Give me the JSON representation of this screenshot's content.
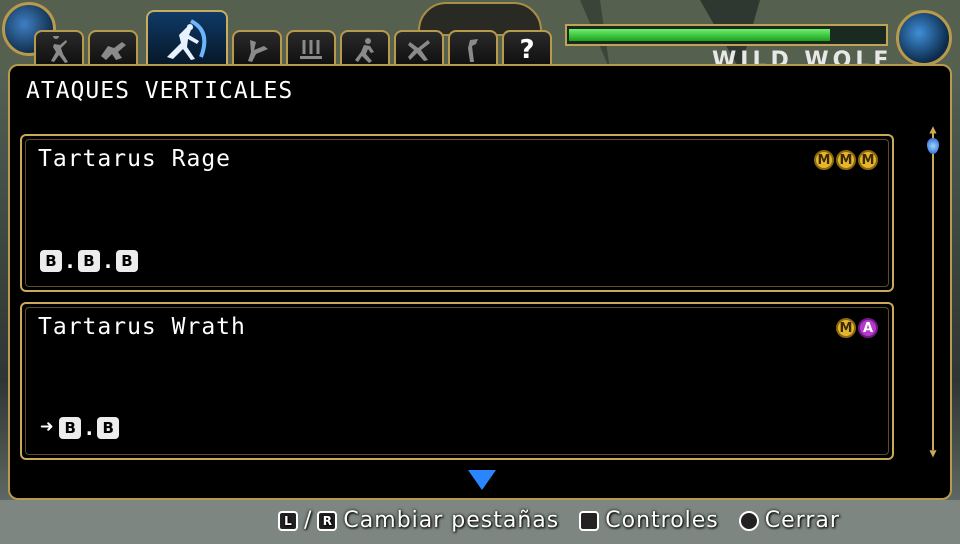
{
  "hud": {
    "enemy_name": "WILD WOLF",
    "health_fraction": 0.83
  },
  "tabs": [
    {
      "icon": "stance-icon",
      "active": false
    },
    {
      "icon": "throw-icon",
      "active": false
    },
    {
      "icon": "vertical-attack-icon",
      "active": true
    },
    {
      "icon": "kick-icon",
      "active": false
    },
    {
      "icon": "down-attack-icon",
      "active": false
    },
    {
      "icon": "run-icon",
      "active": false
    },
    {
      "icon": "special-icon",
      "active": false
    },
    {
      "icon": "stand-icon",
      "active": false
    },
    {
      "icon": "help-icon",
      "label": "?",
      "active": false
    }
  ],
  "panel": {
    "title": "ATAQUES VERTICALES"
  },
  "moves": [
    {
      "name": "Tartarus Rage",
      "tags": [
        "M",
        "M",
        "M"
      ],
      "command": {
        "prefix": "",
        "keys": [
          "B",
          "B",
          "B"
        ],
        "separator": "."
      }
    },
    {
      "name": "Tartarus Wrath",
      "tags": [
        "M",
        "A"
      ],
      "command": {
        "prefix": "➜",
        "keys": [
          "B",
          "B"
        ],
        "separator": "."
      }
    }
  ],
  "footer": {
    "l_key": "L",
    "slash": "/",
    "r_key": "R",
    "change_tabs": "Cambiar pestañas",
    "square_key": "□",
    "controls": "Controles",
    "circle_key": "○",
    "close": "Cerrar"
  },
  "colors": {
    "gold": "#c9a95a",
    "active_tab": "#0f3a66",
    "health": "#2ecb2e",
    "tag_m": "#e6b52b",
    "tag_a": "#b63acc",
    "scroll_arrow": "#2a86ff"
  }
}
